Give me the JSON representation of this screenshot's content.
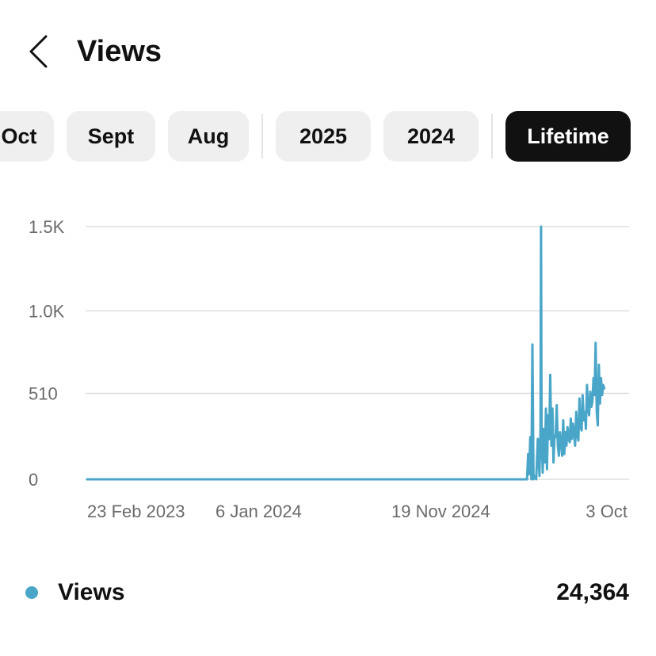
{
  "header": {
    "title": "Views",
    "back_icon": "chevron-left-icon"
  },
  "filters": {
    "items": [
      {
        "label": "Oct",
        "active": false
      },
      {
        "label": "Sept",
        "active": false
      },
      {
        "label": "Aug",
        "active": false
      },
      {
        "label": "2025",
        "active": false
      },
      {
        "label": "2024",
        "active": false
      },
      {
        "label": "Lifetime",
        "active": true
      }
    ]
  },
  "colors": {
    "series": "#4aa6c9",
    "active_chip_bg": "#111111",
    "chip_bg": "#efefef",
    "grid": "#dddddd",
    "tick_text": "#6b6b6b"
  },
  "chart_data": {
    "type": "line",
    "title": "",
    "xlabel": "",
    "ylabel": "",
    "ylim": [
      0,
      1500
    ],
    "y_ticks": [
      "0",
      "510",
      "1.0K",
      "1.5K"
    ],
    "y_tick_values": [
      0,
      510,
      1000,
      1500
    ],
    "x_ticks": [
      "23 Feb 2023",
      "6 Jan 2024",
      "19 Nov 2024",
      "3 Oct"
    ],
    "x_tick_dates": [
      "2023-02-23",
      "2024-01-06",
      "2024-11-19",
      "2025-10-03"
    ],
    "grid": true,
    "series": [
      {
        "name": "Views",
        "x": [
          "2023-02-23",
          "2025-05-15",
          "2025-05-17",
          "2025-05-19",
          "2025-05-21",
          "2025-05-23",
          "2025-05-25",
          "2025-05-27",
          "2025-05-29",
          "2025-05-31",
          "2025-06-03",
          "2025-06-06",
          "2025-06-09",
          "2025-06-11",
          "2025-06-12",
          "2025-06-13",
          "2025-06-15",
          "2025-06-17",
          "2025-06-19",
          "2025-06-21",
          "2025-06-23",
          "2025-06-25",
          "2025-06-27",
          "2025-06-29",
          "2025-07-01",
          "2025-07-03",
          "2025-07-05",
          "2025-07-07",
          "2025-07-09",
          "2025-07-11",
          "2025-07-13",
          "2025-07-15",
          "2025-07-17",
          "2025-07-19",
          "2025-07-21",
          "2025-07-23",
          "2025-07-25",
          "2025-07-27",
          "2025-07-29",
          "2025-07-31",
          "2025-08-02",
          "2025-08-04",
          "2025-08-06",
          "2025-08-08",
          "2025-08-10",
          "2025-08-12",
          "2025-08-14",
          "2025-08-16",
          "2025-08-18",
          "2025-08-20",
          "2025-08-22",
          "2025-08-24",
          "2025-08-26",
          "2025-08-28",
          "2025-08-30",
          "2025-09-01",
          "2025-09-03",
          "2025-09-05",
          "2025-09-07",
          "2025-09-09",
          "2025-09-11",
          "2025-09-13",
          "2025-09-15",
          "2025-09-17",
          "2025-09-19",
          "2025-09-21",
          "2025-09-23",
          "2025-09-25",
          "2025-09-27",
          "2025-09-29",
          "2025-10-01",
          "2025-10-03",
          "2025-10-05",
          "2025-10-07"
        ],
        "y": [
          0,
          0,
          0,
          150,
          30,
          250,
          0,
          800,
          0,
          20,
          0,
          240,
          20,
          300,
          1500,
          250,
          40,
          300,
          100,
          420,
          60,
          380,
          240,
          620,
          200,
          420,
          100,
          260,
          250,
          440,
          200,
          140,
          280,
          220,
          140,
          350,
          150,
          280,
          200,
          310,
          240,
          220,
          360,
          240,
          330,
          280,
          200,
          400,
          260,
          230,
          480,
          310,
          290,
          500,
          350,
          400,
          300,
          560,
          420,
          380,
          520,
          430,
          460,
          600,
          500,
          810,
          400,
          320,
          680,
          450,
          600,
          500,
          560,
          540
        ]
      }
    ]
  },
  "legend": {
    "label": "Views",
    "total": "24,364"
  }
}
